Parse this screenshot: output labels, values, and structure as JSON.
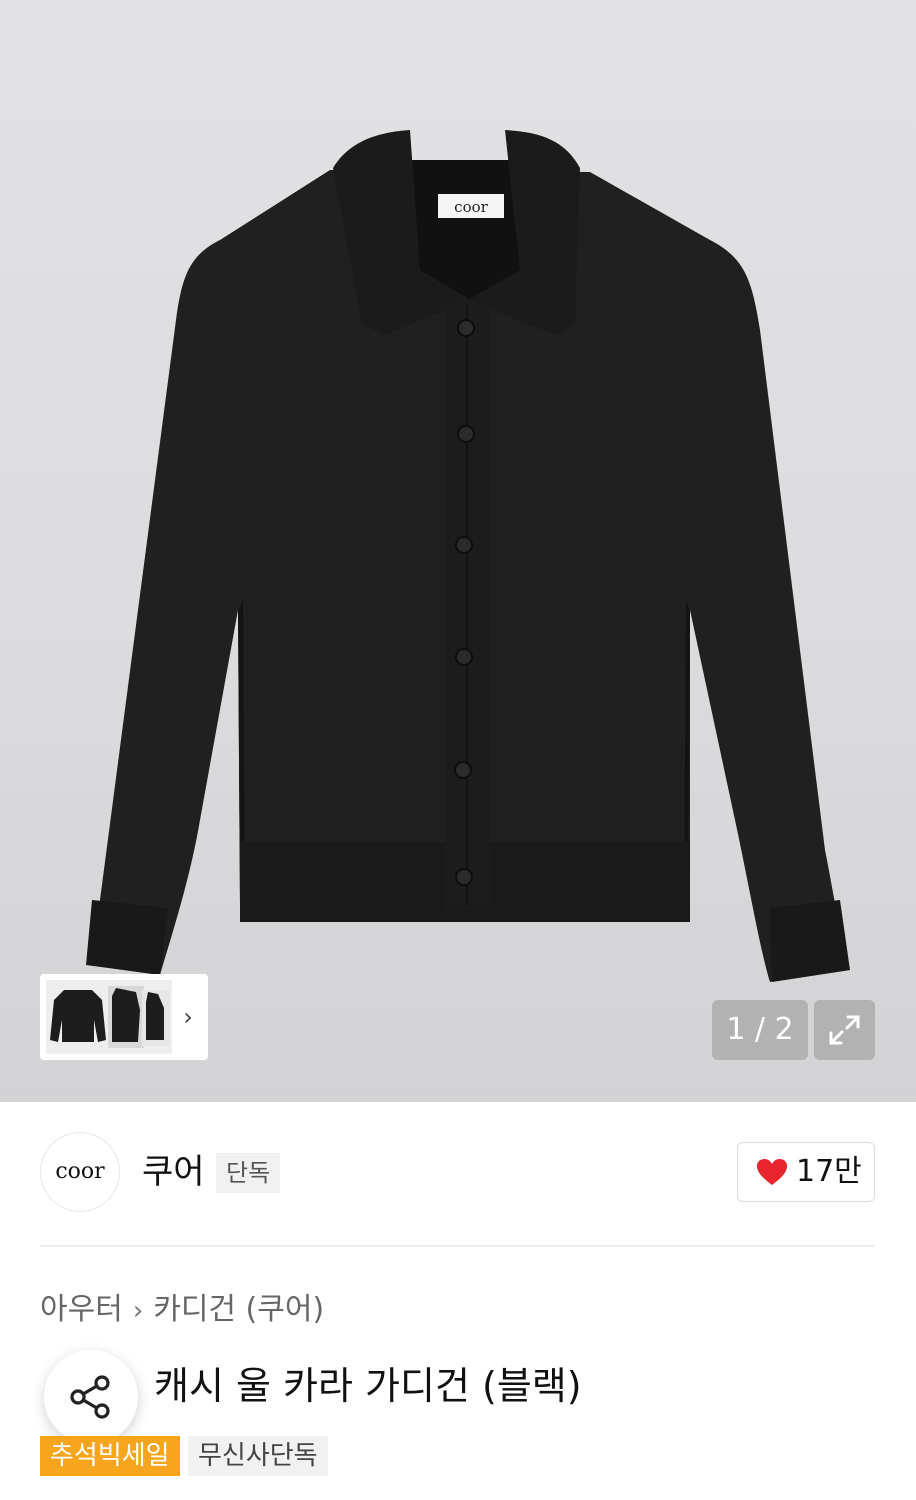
{
  "gallery": {
    "counter": "1 / 2",
    "label_text": "coor",
    "next_arrow": "›",
    "expand_icon": "expand-icon"
  },
  "brand": {
    "logo_text": "coor",
    "name": "쿠어",
    "tag": "단독",
    "like_count": "17만",
    "like_color": "#e8252f"
  },
  "product": {
    "category": "아우터",
    "subcategory": "카디건 (쿠어)",
    "breadcrumb_sep": "›",
    "title": "캐시 울 카라 가디건 (블랙)",
    "badges": {
      "sale": "추석빅세일",
      "exclusive": "무신사단독"
    },
    "badge_sale_color": "#f7a51c"
  }
}
